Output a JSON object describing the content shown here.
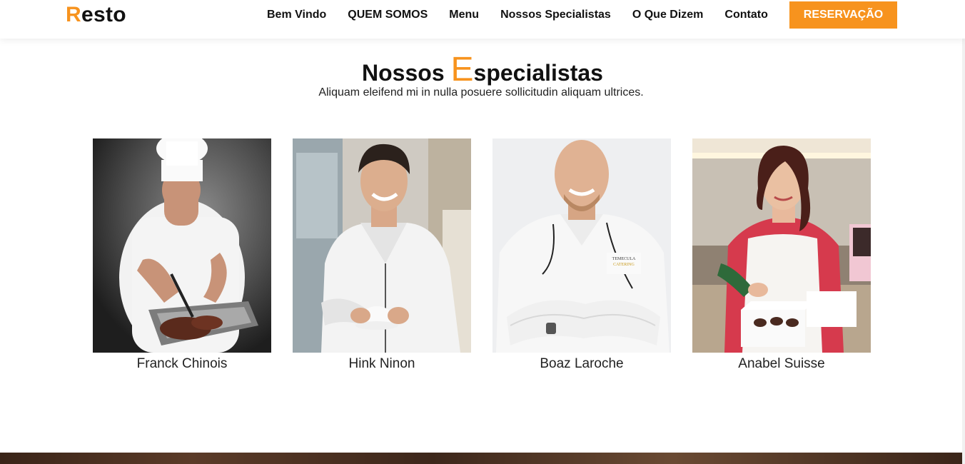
{
  "brand": {
    "first_letter": "R",
    "rest": "esto"
  },
  "nav": {
    "links": [
      "Bem Vindo",
      "QUEM SOMOS",
      "Menu",
      "Nossos Specialistas",
      "O Que Dizem",
      "Contato"
    ],
    "cta": "RESERVAÇÃO"
  },
  "section": {
    "title_first": "Nossos ",
    "title_highlight": "E",
    "title_rest": "specialistas",
    "subtitle": "Aliquam eleifend mi in nulla posuere sollicitudin aliquam ultrices."
  },
  "specialists": [
    {
      "name": "Franck Chinois"
    },
    {
      "name": "Hink Ninon"
    },
    {
      "name": "Boaz Laroche"
    },
    {
      "name": "Anabel Suisse"
    }
  ],
  "colors": {
    "accent": "#f7931e"
  }
}
